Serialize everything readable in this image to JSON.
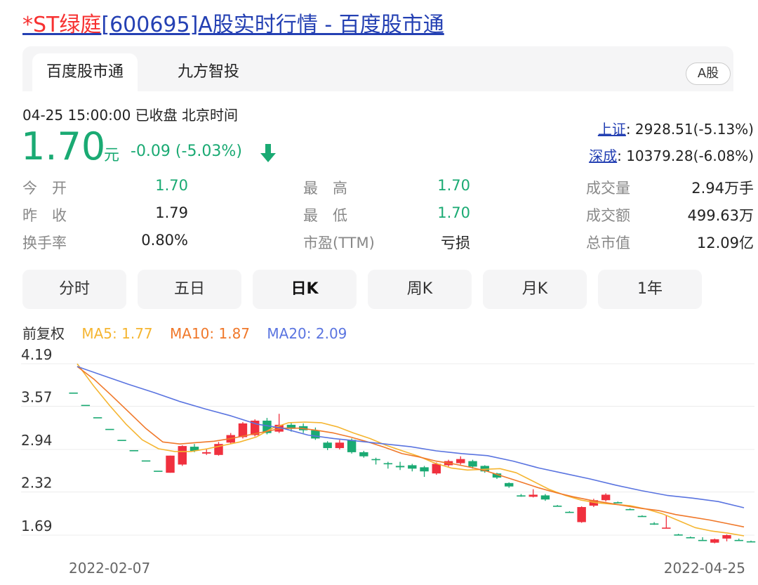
{
  "page": {
    "title_prefix": "*ST绿庭",
    "title_rest": "[600695]A股实时行情 - 百度股市通"
  },
  "tabs": [
    {
      "label": "百度股市通"
    },
    {
      "label": "九方智投"
    }
  ],
  "market_badge": "A股",
  "quote": {
    "time_status": "04-25 15:00:00  已收盘  北京时间",
    "price": "1.70",
    "unit": "元",
    "change": "-0.09 (-5.03%)"
  },
  "indices": [
    {
      "name": "上证",
      "value": ": 2928.51(-5.13%)"
    },
    {
      "name": "深成",
      "value": ": 10379.28(-6.08%)"
    }
  ],
  "stats": [
    {
      "label": "今　开",
      "value": "1.70"
    },
    {
      "label": "昨　收",
      "value": "1.79"
    },
    {
      "label": "换手率",
      "value": "0.80%"
    },
    {
      "label": "最　高",
      "value": "1.70"
    },
    {
      "label": "最　低",
      "value": "1.70"
    },
    {
      "label": "市盈(TTM)",
      "value": "亏损"
    },
    {
      "label": "成交量",
      "value": "2.94万手"
    },
    {
      "label": "成交额",
      "value": "499.63万"
    },
    {
      "label": "总市值",
      "value": "12.09亿"
    }
  ],
  "periods": [
    {
      "label": "分时"
    },
    {
      "label": "五日"
    },
    {
      "label": "日K"
    },
    {
      "label": "周K"
    },
    {
      "label": "月K"
    },
    {
      "label": "1年"
    }
  ],
  "legend": {
    "adjust": "前复权",
    "ma5": "MA5: 1.77",
    "ma10": "MA10: 1.87",
    "ma20": "MA20: 2.09"
  },
  "colors": {
    "up": "#f0303e",
    "down": "#1aaa73",
    "ma5": "#f5b530",
    "ma10": "#f0782a",
    "ma20": "#5a74e0",
    "link": "#2440b3"
  },
  "chart_data": {
    "type": "candlestick",
    "y_ticks": [
      "4.19",
      "3.57",
      "2.94",
      "2.32",
      "1.69"
    ],
    "ylim": [
      1.55,
      4.19
    ],
    "x_labels": [
      "2022-02-07",
      "2022-04-25"
    ],
    "candles": [
      {
        "o": 3.77,
        "c": 3.77,
        "h": 3.77,
        "l": 3.77
      },
      {
        "o": 3.59,
        "c": 3.59,
        "h": 3.59,
        "l": 3.59
      },
      {
        "o": 3.41,
        "c": 3.41,
        "h": 3.41,
        "l": 3.41
      },
      {
        "o": 3.24,
        "c": 3.24,
        "h": 3.24,
        "l": 3.24
      },
      {
        "o": 3.08,
        "c": 3.08,
        "h": 3.08,
        "l": 3.08
      },
      {
        "o": 2.93,
        "c": 2.93,
        "h": 2.93,
        "l": 2.93
      },
      {
        "o": 2.78,
        "c": 2.78,
        "h": 2.78,
        "l": 2.78
      },
      {
        "o": 2.63,
        "c": 2.63,
        "h": 2.63,
        "l": 2.63
      },
      {
        "o": 2.6,
        "c": 2.85,
        "h": 2.85,
        "l": 2.6
      },
      {
        "o": 2.72,
        "c": 2.99,
        "h": 3.0,
        "l": 2.7
      },
      {
        "o": 2.98,
        "c": 2.92,
        "h": 3.02,
        "l": 2.9
      },
      {
        "o": 2.88,
        "c": 2.9,
        "h": 2.95,
        "l": 2.86
      },
      {
        "o": 2.86,
        "c": 3.02,
        "h": 3.05,
        "l": 2.85
      },
      {
        "o": 3.04,
        "c": 3.15,
        "h": 3.18,
        "l": 3.02
      },
      {
        "o": 3.12,
        "c": 3.32,
        "h": 3.34,
        "l": 3.1
      },
      {
        "o": 3.15,
        "c": 3.36,
        "h": 3.38,
        "l": 3.13
      },
      {
        "o": 3.36,
        "c": 3.18,
        "h": 3.4,
        "l": 3.16
      },
      {
        "o": 3.2,
        "c": 3.3,
        "h": 3.46,
        "l": 3.18
      },
      {
        "o": 3.3,
        "c": 3.24,
        "h": 3.34,
        "l": 3.2
      },
      {
        "o": 3.28,
        "c": 3.22,
        "h": 3.32,
        "l": 3.18
      },
      {
        "o": 3.22,
        "c": 3.1,
        "h": 3.26,
        "l": 3.08
      },
      {
        "o": 3.04,
        "c": 2.96,
        "h": 3.06,
        "l": 2.93
      },
      {
        "o": 2.96,
        "c": 3.04,
        "h": 3.08,
        "l": 2.94
      },
      {
        "o": 3.08,
        "c": 2.9,
        "h": 3.1,
        "l": 2.88
      },
      {
        "o": 2.9,
        "c": 2.84,
        "h": 2.92,
        "l": 2.82
      },
      {
        "o": 2.8,
        "c": 2.8,
        "h": 2.82,
        "l": 2.72
      },
      {
        "o": 2.74,
        "c": 2.74,
        "h": 2.76,
        "l": 2.66
      },
      {
        "o": 2.7,
        "c": 2.68,
        "h": 2.76,
        "l": 2.64
      },
      {
        "o": 2.71,
        "c": 2.66,
        "h": 2.73,
        "l": 2.62
      },
      {
        "o": 2.68,
        "c": 2.62,
        "h": 2.7,
        "l": 2.54
      },
      {
        "o": 2.59,
        "c": 2.73,
        "h": 2.75,
        "l": 2.57
      },
      {
        "o": 2.71,
        "c": 2.77,
        "h": 2.79,
        "l": 2.69
      },
      {
        "o": 2.74,
        "c": 2.8,
        "h": 2.84,
        "l": 2.72
      },
      {
        "o": 2.77,
        "c": 2.69,
        "h": 2.79,
        "l": 2.66
      },
      {
        "o": 2.7,
        "c": 2.62,
        "h": 2.71,
        "l": 2.6
      },
      {
        "o": 2.59,
        "c": 2.53,
        "h": 2.6,
        "l": 2.51
      },
      {
        "o": 2.45,
        "c": 2.4,
        "h": 2.46,
        "l": 2.38
      },
      {
        "o": 2.27,
        "c": 2.27,
        "h": 2.29,
        "l": 2.25
      },
      {
        "o": 2.25,
        "c": 2.28,
        "h": 2.36,
        "l": 2.24
      },
      {
        "o": 2.27,
        "c": 2.21,
        "h": 2.29,
        "l": 2.19
      },
      {
        "o": 2.12,
        "c": 2.12,
        "h": 2.13,
        "l": 2.11
      },
      {
        "o": 2.03,
        "c": 2.03,
        "h": 2.04,
        "l": 2.02
      },
      {
        "o": 1.88,
        "c": 2.1,
        "h": 2.11,
        "l": 1.87
      },
      {
        "o": 2.12,
        "c": 2.2,
        "h": 2.22,
        "l": 2.1
      },
      {
        "o": 2.2,
        "c": 2.28,
        "h": 2.3,
        "l": 2.18
      },
      {
        "o": 2.17,
        "c": 2.17,
        "h": 2.18,
        "l": 2.16
      },
      {
        "o": 2.07,
        "c": 2.07,
        "h": 2.08,
        "l": 2.06
      },
      {
        "o": 1.97,
        "c": 1.97,
        "h": 1.98,
        "l": 1.96
      },
      {
        "o": 1.86,
        "c": 1.86,
        "h": 1.88,
        "l": 1.84
      },
      {
        "o": 1.79,
        "c": 1.8,
        "h": 1.98,
        "l": 1.79
      },
      {
        "o": 1.7,
        "c": 1.7,
        "h": 1.71,
        "l": 1.69
      },
      {
        "o": 1.66,
        "c": 1.66,
        "h": 1.67,
        "l": 1.65
      },
      {
        "o": 1.62,
        "c": 1.62,
        "h": 1.66,
        "l": 1.61
      },
      {
        "o": 1.58,
        "c": 1.63,
        "h": 1.64,
        "l": 1.57
      },
      {
        "o": 1.64,
        "c": 1.69,
        "h": 1.7,
        "l": 1.6
      },
      {
        "o": 1.62,
        "c": 1.62,
        "h": 1.64,
        "l": 1.61
      },
      {
        "o": 1.6,
        "c": 1.6,
        "h": 1.61,
        "l": 1.59
      }
    ],
    "series": [
      {
        "name": "MA5",
        "values": [
          4.19,
          3.87,
          3.58,
          3.31,
          3.08,
          2.95,
          2.91,
          2.91,
          2.95,
          3.0,
          3.05,
          3.12,
          3.25,
          3.33,
          3.34,
          3.33,
          3.27,
          3.18,
          3.1,
          3.0,
          2.92,
          2.84,
          2.74,
          2.67,
          2.64,
          2.65,
          2.66,
          2.6,
          2.48,
          2.36,
          2.27,
          2.2,
          2.16,
          2.14,
          2.12,
          2.07,
          2.0,
          1.9,
          1.8,
          1.75,
          1.72,
          1.68
        ]
      },
      {
        "name": "MA10",
        "values": [
          4.15,
          3.96,
          3.73,
          3.49,
          3.25,
          3.05,
          3.02,
          3.04,
          3.06,
          3.1,
          3.15,
          3.2,
          3.25,
          3.25,
          3.22,
          3.18,
          3.12,
          3.05,
          2.97,
          2.88,
          2.83,
          2.77,
          2.73,
          2.68,
          2.62,
          2.54,
          2.46,
          2.38,
          2.31,
          2.25,
          2.2,
          2.16,
          2.12,
          2.08,
          2.05,
          1.99,
          1.95,
          1.91,
          1.86,
          1.81
        ]
      },
      {
        "name": "MA20",
        "values": [
          4.15,
          4.02,
          3.89,
          3.77,
          3.64,
          3.53,
          3.43,
          3.31,
          3.25,
          3.15,
          3.1,
          3.06,
          3.02,
          2.98,
          2.92,
          2.88,
          2.85,
          2.77,
          2.67,
          2.59,
          2.51,
          2.42,
          2.34,
          2.27,
          2.23,
          2.18,
          2.09
        ]
      }
    ]
  }
}
